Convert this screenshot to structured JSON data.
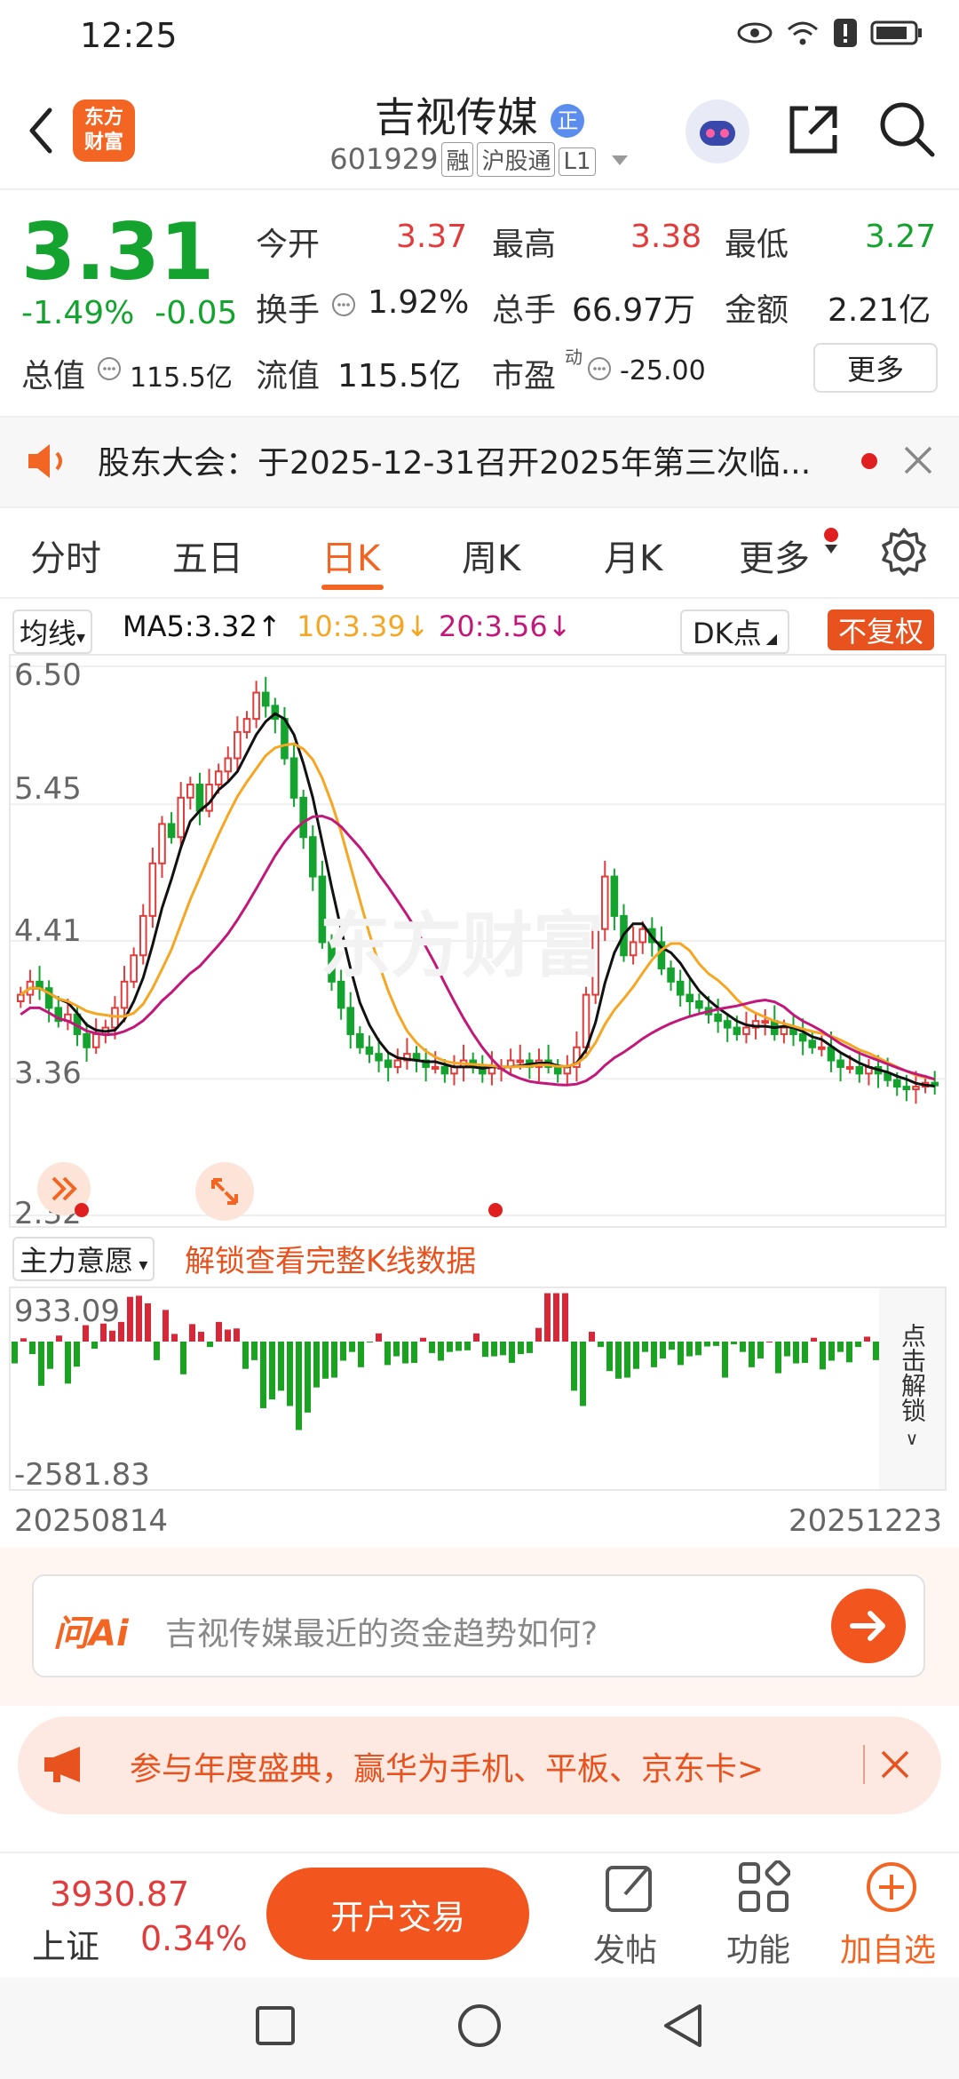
{
  "status": {
    "time": "12:25"
  },
  "header": {
    "logo_line1": "东方",
    "logo_line2": "财富",
    "title": "吉视传媒",
    "title_badge": "正",
    "code": "601929",
    "tags": [
      "融",
      "沪股通",
      "L1"
    ]
  },
  "quote": {
    "price": "3.31",
    "change_pct": "-1.49%",
    "change": "-0.05",
    "open_label": "今开",
    "open": "3.37",
    "high_label": "最高",
    "high": "3.38",
    "low_label": "最低",
    "low": "3.27",
    "turnover_label": "换手",
    "turnover": "1.92%",
    "volume_label": "总手",
    "volume": "66.97万",
    "amount_label": "金额",
    "amount": "2.21亿",
    "mktcap_label": "总值",
    "mktcap": "115.5亿",
    "float_label": "流值",
    "float": "115.5亿",
    "pe_label": "市盈",
    "pe_sup": "动",
    "pe": "-25.00",
    "more_label": "更多"
  },
  "notice": {
    "text": "股东大会：于2025-12-31召开2025年第三次临..."
  },
  "tabs": [
    "分时",
    "五日",
    "日K",
    "周K",
    "月K",
    "更多"
  ],
  "active_tab": "日K",
  "chart": {
    "ma_select": "均线",
    "ma5": "MA5:3.32↑",
    "ma10": "10:3.39↓",
    "ma20": "20:3.56↓",
    "dk_label": "DK点",
    "adjust_label": "不复权",
    "y_labels": [
      "6.50",
      "5.45",
      "4.41",
      "3.36",
      "2.32"
    ],
    "ma_colors": {
      "ma5": "#111111",
      "ma10": "#f5a623",
      "ma20": "#c2187a"
    },
    "indicator_select": "主力意愿",
    "unlock_text": "解锁查看完整K线数据",
    "vol_max": "933.09",
    "vol_min": "-2581.83",
    "unlock_side": "点击解锁",
    "date_start": "20250814",
    "date_end": "20251223"
  },
  "chart_data": {
    "type": "candlestick",
    "ylim": [
      2.32,
      6.5
    ],
    "y_ticks": [
      6.5,
      5.45,
      4.41,
      3.36,
      2.32
    ],
    "x_range": [
      "20250814",
      "20251223"
    ],
    "closes": [
      4.0,
      4.1,
      4.05,
      3.9,
      3.8,
      3.85,
      3.7,
      3.6,
      3.7,
      3.75,
      3.9,
      4.1,
      4.3,
      4.6,
      5.0,
      5.3,
      5.2,
      5.5,
      5.6,
      5.4,
      5.6,
      5.7,
      5.8,
      6.0,
      6.1,
      6.3,
      6.2,
      6.1,
      5.8,
      5.5,
      5.2,
      4.9,
      4.4,
      4.1,
      3.9,
      3.7,
      3.6,
      3.55,
      3.5,
      3.45,
      3.5,
      3.55,
      3.5,
      3.45,
      3.45,
      3.4,
      3.45,
      3.5,
      3.45,
      3.4,
      3.45,
      3.45,
      3.5,
      3.5,
      3.45,
      3.5,
      3.45,
      3.4,
      3.45,
      3.6,
      4.0,
      4.5,
      4.9,
      4.6,
      4.3,
      4.4,
      4.5,
      4.4,
      4.2,
      4.1,
      4.0,
      3.95,
      3.9,
      3.85,
      3.8,
      3.75,
      3.7,
      3.75,
      3.8,
      3.8,
      3.7,
      3.75,
      3.7,
      3.65,
      3.6,
      3.6,
      3.5,
      3.45,
      3.45,
      3.4,
      3.45,
      3.4,
      3.35,
      3.3,
      3.28,
      3.3,
      3.33,
      3.31
    ],
    "ma_series": [
      "MA5",
      "MA10",
      "MA20"
    ],
    "ma_last": {
      "MA5": 3.32,
      "MA10": 3.39,
      "MA20": 3.56
    },
    "indicator": "主力意愿",
    "indicator_range": [
      -2581.83,
      933.09
    ]
  },
  "ai": {
    "label": "问Ai",
    "question": "吉视传媒最近的资金趋势如何?"
  },
  "promo": {
    "text": "参与年度盛典，赢华为手机、平板、京东卡>"
  },
  "bottom": {
    "index_value": "3930.87",
    "index_name": "上证",
    "index_change": "0.34%",
    "trade_button": "开户交易",
    "post": "发帖",
    "function": "功能",
    "add_watch": "加自选"
  }
}
